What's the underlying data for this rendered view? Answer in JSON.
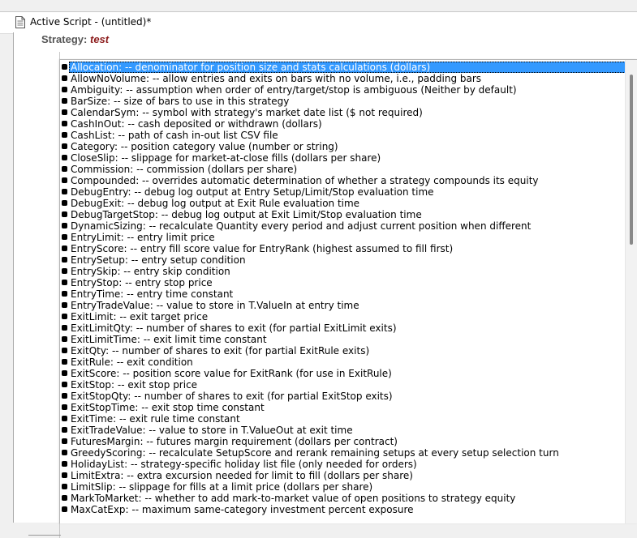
{
  "window": {
    "title": "Active Script - (untitled)*",
    "icon": "document-icon"
  },
  "editor": {
    "strategy_keyword": "Strategy:",
    "strategy_name": "test"
  },
  "autocomplete": {
    "selected_index": 0,
    "items": [
      "Allocation: -- denominator for position size and stats calculations (dollars)",
      "AllowNoVolume: -- allow entries and exits on bars with no volume, i.e., padding bars",
      "Ambiguity: -- assumption when order of entry/target/stop is ambiguous (Neither by default)",
      "BarSize: -- size of bars to use in this strategy",
      "CalendarSym: -- symbol with strategy's market date list ($ not required)",
      "CashInOut: -- cash deposited or withdrawn (dollars)",
      "CashList: -- path of cash in-out list CSV file",
      "Category: -- position category value (number or string)",
      "CloseSlip: -- slippage for market-at-close fills (dollars per share)",
      "Commission: -- commission (dollars per share)",
      "Compounded: -- overrides automatic determination of whether a strategy compounds its equity",
      "DebugEntry: -- debug log output at Entry Setup/Limit/Stop evaluation time",
      "DebugExit: -- debug log output at Exit Rule evaluation time",
      "DebugTargetStop: -- debug log output at Exit Limit/Stop evaluation time",
      "DynamicSizing: -- recalculate Quantity every period and adjust current position when different",
      "EntryLimit: -- entry limit price",
      "EntryScore: -- entry fill score value for EntryRank (highest assumed to fill first)",
      "EntrySetup: -- entry setup condition",
      "EntrySkip: -- entry skip condition",
      "EntryStop: -- entry stop price",
      "EntryTime: -- entry time constant",
      "EntryTradeValue: -- value to store in T.ValueIn at entry time",
      "ExitLimit: -- exit target price",
      "ExitLimitQty: -- number of shares to exit (for partial ExitLimit exits)",
      "ExitLimitTime: -- exit limit time constant",
      "ExitQty: -- number of shares to exit (for partial ExitRule exits)",
      "ExitRule: -- exit condition",
      "ExitScore: -- position score value for ExitRank (for use in ExitRule)",
      "ExitStop: -- exit stop price",
      "ExitStopQty: -- number of shares to exit (for partial ExitStop exits)",
      "ExitStopTime: -- exit stop time constant",
      "ExitTime: -- exit rule time constant",
      "ExitTradeValue: -- value to store in T.ValueOut at exit time",
      "FuturesMargin: -- futures margin requirement (dollars per contract)",
      "GreedyScoring: -- recalculate SetupScore and rerank remaining setups at every setup selection turn",
      "HolidayList: -- strategy-specific holiday list file (only needed for orders)",
      "LimitExtra: -- extra excursion needed for limit to fill (dollars per share)",
      "LimitSlip: -- slippage for fills at a limit price (dollars per share)",
      "MarkToMarket: -- whether to add mark-to-market value of open positions to strategy equity",
      "MaxCatExp: -- maximum same-category investment percent exposure"
    ]
  },
  "colors": {
    "selection": "#3399ff",
    "strategy_name": "#8b1a1a"
  }
}
